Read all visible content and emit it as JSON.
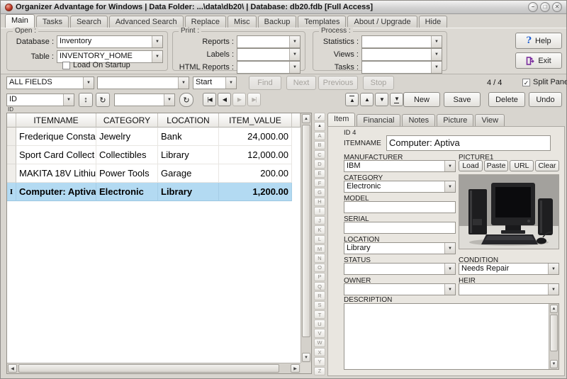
{
  "window": {
    "title": "Organizer Advantage for Windows | Data Folder: ...\\data\\db20\\ | Database: db20.fdb [Full Access]"
  },
  "icons": {
    "minimize": "–",
    "maximize": "□",
    "close": "✕",
    "dropdown": "▼",
    "sort": "↕",
    "refresh": "↻",
    "nav_first": "|◀",
    "nav_prev": "◀",
    "nav_next": "▶",
    "nav_last": "▶|",
    "rec_up": "▲",
    "rec_down": "▼",
    "check": "✓",
    "up": "▲",
    "down": "▼",
    "left": "◀",
    "right": "▶",
    "help_qmark": "?"
  },
  "main_tabs": {
    "items": [
      "Main",
      "Tasks",
      "Search",
      "Advanced Search",
      "Replace",
      "Misc",
      "Backup",
      "Templates",
      "About / Upgrade",
      "Hide"
    ],
    "active": "Main"
  },
  "open_group": {
    "legend": "Open :",
    "database_label": "Database :",
    "database_value": "Inventory",
    "table_label": "Table :",
    "table_value": "INVENTORY_HOME",
    "startup_label": "Load On Startup",
    "startup_checked": ""
  },
  "print_group": {
    "legend": "Print :",
    "rows": [
      {
        "label": "Reports :",
        "value": ""
      },
      {
        "label": "Labels :",
        "value": ""
      },
      {
        "label": "HTML Reports :",
        "value": ""
      }
    ]
  },
  "process_group": {
    "legend": "Process :",
    "rows": [
      {
        "label": "Statistics :",
        "value": ""
      },
      {
        "label": "Views :",
        "value": ""
      },
      {
        "label": "Tasks :",
        "value": ""
      }
    ]
  },
  "actions": {
    "help": "Help",
    "exit": "Exit"
  },
  "find_bar": {
    "field_combo": "ALL FIELDS",
    "term_combo": "",
    "mode_combo": "Start",
    "find": "Find",
    "next": "Next",
    "previous": "Previous",
    "stop": "Stop",
    "counter": "4 / 4",
    "split_label": "Split Panels",
    "split_checked": "✓"
  },
  "sort_bar": {
    "sort_combo": "ID",
    "sort_caption": "ID",
    "filter_combo": ""
  },
  "record_actions": {
    "new": "New",
    "save": "Save",
    "delete": "Delete",
    "undo": "Undo"
  },
  "grid": {
    "columns": [
      "ITEMNAME",
      "CATEGORY",
      "LOCATION",
      "ITEM_VALUE"
    ],
    "rows": [
      {
        "marker": "",
        "itemname": "Frederique Consta",
        "category": "Jewelry",
        "location": "Bank",
        "value": "24,000.00",
        "selected": false
      },
      {
        "marker": "",
        "itemname": "Sport Card Collect",
        "category": "Collectibles",
        "location": "Library",
        "value": "12,000.00",
        "selected": false
      },
      {
        "marker": "",
        "itemname": "MAKITA 18V Lithiu",
        "category": "Power Tools",
        "location": "Garage",
        "value": "200.00",
        "selected": false
      },
      {
        "marker": "I",
        "itemname": "Computer: Aptiva",
        "category": "Electronic",
        "location": "Library",
        "value": "1,200.00",
        "selected": true
      }
    ]
  },
  "alphabet": {
    "letters": [
      "A",
      "B",
      "C",
      "D",
      "E",
      "F",
      "G",
      "H",
      "I",
      "J",
      "K",
      "L",
      "M",
      "N",
      "O",
      "P",
      "Q",
      "R",
      "S",
      "T",
      "U",
      "V",
      "W",
      "X",
      "Y",
      "Z"
    ]
  },
  "detail": {
    "tabs": [
      "Item",
      "Financial",
      "Notes",
      "Picture",
      "View"
    ],
    "active_tab": "Item",
    "record_id": "ID 4",
    "itemname_label": "ITEMNAME",
    "itemname_value": "Computer: Aptiva",
    "fields_left": [
      {
        "label": "MANUFACTURER",
        "value": "IBM",
        "type": "combo"
      },
      {
        "label": "CATEGORY",
        "value": "Electronic",
        "type": "combo"
      },
      {
        "label": "MODEL",
        "value": "",
        "type": "input"
      },
      {
        "label": "SERIAL",
        "value": "",
        "type": "input"
      },
      {
        "label": "LOCATION",
        "value": "Library",
        "type": "combo"
      },
      {
        "label": "STATUS",
        "value": "",
        "type": "combo"
      },
      {
        "label": "OWNER",
        "value": "",
        "type": "combo"
      }
    ],
    "picture": {
      "label": "PICTURE1",
      "buttons": [
        "Load",
        "Paste",
        "URL",
        "Clear"
      ]
    },
    "condition": {
      "label": "CONDITION",
      "value": "Needs Repair"
    },
    "heir": {
      "label": "HEIR",
      "value": ""
    },
    "description_label": "DESCRIPTION",
    "description_value": ""
  },
  "colors": {
    "selection": "#b3daf2",
    "help_accent": "#1f5fd0",
    "exit_accent": "#7b2e9e"
  }
}
